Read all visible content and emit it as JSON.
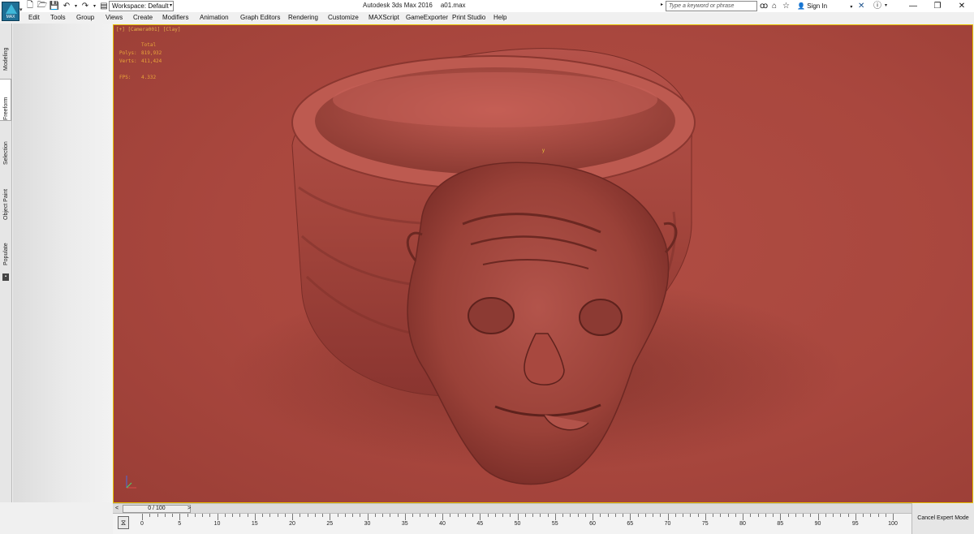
{
  "app": {
    "title": "Autodesk 3ds Max 2016",
    "file": "a01.max",
    "logo_text": "MAX",
    "workspace": "Workspace: Default"
  },
  "search": {
    "placeholder": "Type a keyword or phrase"
  },
  "account": {
    "sign_in": "Sign In"
  },
  "menu": [
    "Edit",
    "Tools",
    "Group",
    "Views",
    "Create",
    "Modifiers",
    "Animation",
    "Graph Editors",
    "Rendering",
    "Customize",
    "MAXScript",
    "GameExporter",
    "Print Studio",
    "Help"
  ],
  "command_tabs": [
    "Modeling",
    "Freeform",
    "Selection",
    "Object Paint",
    "Populate"
  ],
  "viewport": {
    "label": "[+] [Camera001] [Clay]",
    "stats": {
      "header": "Total",
      "polys_label": "Polys:",
      "polys": "819,932",
      "verts_label": "Verts:",
      "verts": "411,424",
      "fps_label": "FPS:",
      "fps": "4.332"
    },
    "gizmo_y": "y",
    "colors": {
      "background": "#a9473e",
      "border": "#e8c100",
      "overlay_text": "#e9a53a"
    }
  },
  "time_slider": {
    "prev": "<",
    "position": "0 / 100",
    "next": ">"
  },
  "track_bar": {
    "ticks": [
      "0",
      "5",
      "10",
      "15",
      "20",
      "25",
      "30",
      "35",
      "40",
      "45",
      "50",
      "55",
      "60",
      "65",
      "70",
      "75",
      "80",
      "85",
      "90",
      "95",
      "100"
    ]
  },
  "status": {
    "expert_mode_button": "Cancel Expert Mode"
  }
}
